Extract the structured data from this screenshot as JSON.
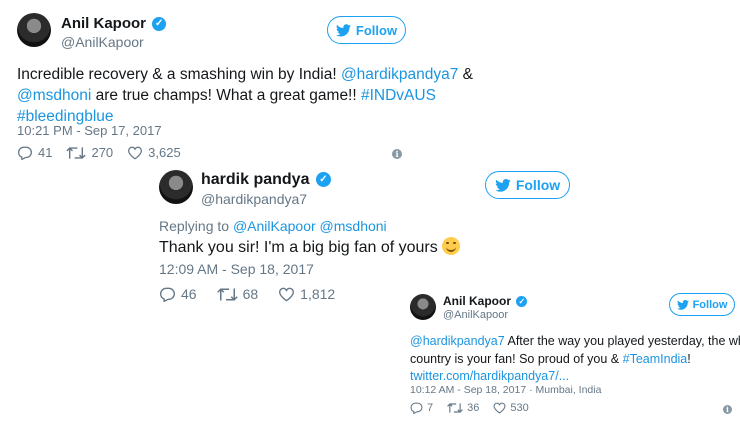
{
  "tweets": [
    {
      "name": "Anil Kapoor",
      "handle": "@AnilKapoor",
      "follow_label": "Follow",
      "text_line1": "Incredible recovery & a smashing win by India! ",
      "mention1": "@hardikpandya7",
      "text_line1_end": " &",
      "mention2": "@msdhoni",
      "text_line2": " are true champs! What a great game!! ",
      "hashtag1": "#INDvAUS",
      "hashtag2": "#bleedingblue",
      "timestamp": "10:21 PM - Sep 17, 2017",
      "replies": "41",
      "retweets": "270",
      "likes": "3,625"
    },
    {
      "name": "hardik pandya",
      "handle": "@hardikpandya7",
      "follow_label": "Follow",
      "replying_prefix": "Replying to ",
      "replying_to1": "@AnilKapoor",
      "replying_to2": "@msdhoni",
      "text": "Thank you sir! I'm a big big fan of yours ",
      "timestamp": "12:09 AM - Sep 18, 2017",
      "replies": "46",
      "retweets": "68",
      "likes": "1,812"
    },
    {
      "name": "Anil Kapoor",
      "handle": "@AnilKapoor",
      "follow_label": "Follow",
      "mention": "@hardikpandya7",
      "text_line1": " After the way you played yesterday, the whole",
      "text_line2": "country is your fan! So proud of you & ",
      "hashtag": "#TeamIndia",
      "text_line2_end": "!",
      "url": "twitter.com/hardikpandya7/...",
      "timestamp": "10:12 AM - Sep 18, 2017 · Mumbai, India",
      "replies": "7",
      "retweets": "36",
      "likes": "530"
    }
  ],
  "colors": {
    "accent": "#1da1f2",
    "link": "#1b95e0",
    "muted": "#657786"
  }
}
